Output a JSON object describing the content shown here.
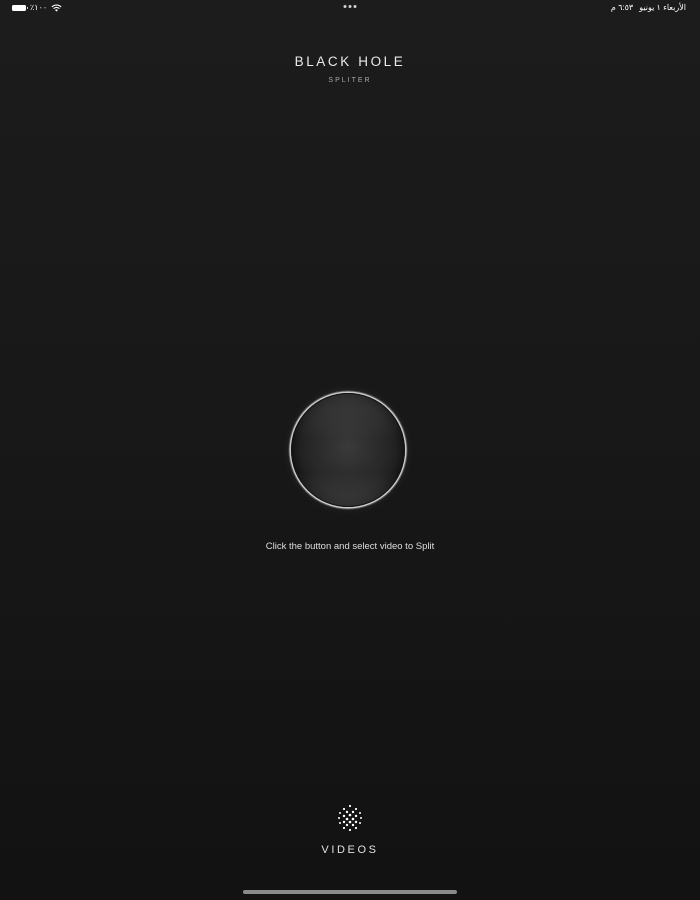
{
  "status_bar": {
    "battery_percent": "٪١٠٠",
    "time": "٦:٥٣ م",
    "date": "الأربعاء ١ يونيو"
  },
  "header": {
    "title": "BLACK HOLE",
    "subtitle": "SPLITER"
  },
  "main": {
    "instruction": "Click the button and select video to Split"
  },
  "bottom": {
    "videos_label": "VIDEOS"
  },
  "icons": {
    "battery": "battery-icon",
    "wifi": "wifi-icon",
    "multitask": "multitask-dots-icon",
    "videos": "dot-grid-icon"
  },
  "colors": {
    "background_top": "#1c1c1c",
    "background_bottom": "#121212",
    "text": "#e6e6e6",
    "button_ring": "#c9c9c9"
  }
}
